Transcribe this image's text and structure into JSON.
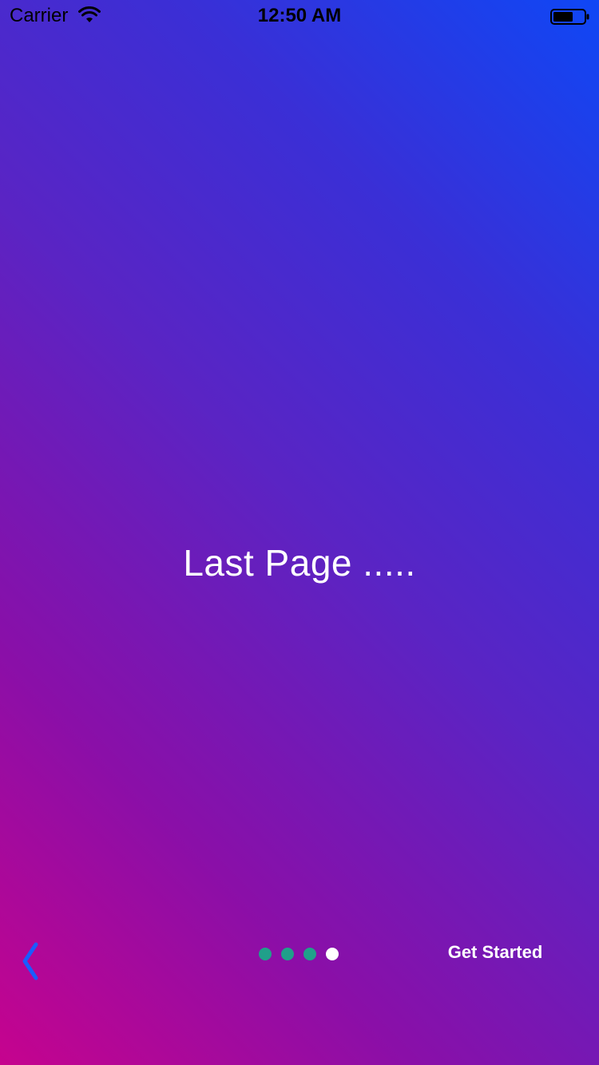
{
  "status_bar": {
    "carrier": "Carrier",
    "time": "12:50 AM",
    "icons": [
      "wifi-icon",
      "battery-icon"
    ]
  },
  "main": {
    "title": "Last Page ....."
  },
  "footer": {
    "back_icon": "chevron-left-icon",
    "page_indicator": {
      "total": 4,
      "current": 4
    },
    "get_started_label": "Get Started"
  },
  "colors": {
    "gradient_top_right": "#0f47f5",
    "gradient_bottom_left": "#c6038e",
    "dot_inactive": "#20a08a",
    "dot_active": "#ffffff",
    "back_chevron": "#1a5cff",
    "text": "#ffffff"
  }
}
